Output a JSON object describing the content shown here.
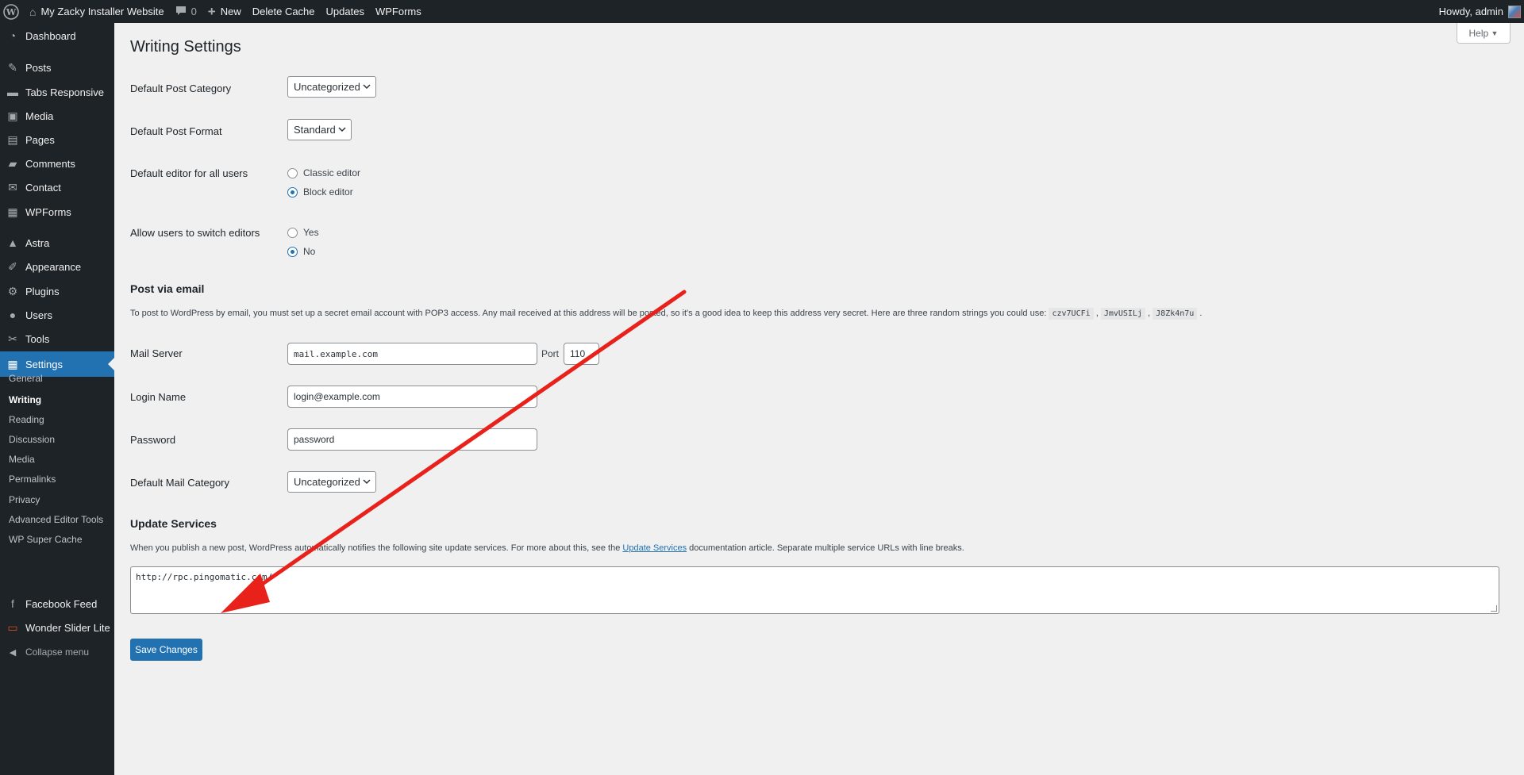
{
  "adminbar": {
    "site_name": "My Zacky Installer Website",
    "comments_count": "0",
    "new_label": "New",
    "delete_cache_label": "Delete Cache",
    "updates_label": "Updates",
    "wpforms_label": "WPForms",
    "howdy": "Howdy, admin"
  },
  "sidebar": {
    "items": [
      {
        "label": "Dashboard",
        "icon": "dashboard-icon"
      },
      {
        "label": "Posts",
        "icon": "pin-icon"
      },
      {
        "label": "Tabs Responsive",
        "icon": "folder-icon"
      },
      {
        "label": "Media",
        "icon": "media-icon"
      },
      {
        "label": "Pages",
        "icon": "pages-icon"
      },
      {
        "label": "Comments",
        "icon": "comment-icon"
      },
      {
        "label": "Contact",
        "icon": "mail-icon"
      },
      {
        "label": "WPForms",
        "icon": "forms-icon"
      },
      {
        "label": "Astra",
        "icon": "astra-icon"
      },
      {
        "label": "Appearance",
        "icon": "brush-icon"
      },
      {
        "label": "Plugins",
        "icon": "plugin-icon"
      },
      {
        "label": "Users",
        "icon": "user-icon"
      },
      {
        "label": "Tools",
        "icon": "wrench-icon"
      },
      {
        "label": "Settings",
        "icon": "settings-icon"
      }
    ],
    "submenu": [
      "General",
      "Writing",
      "Reading",
      "Discussion",
      "Media",
      "Permalinks",
      "Privacy",
      "Advanced Editor Tools",
      "WP Super Cache"
    ],
    "extra": [
      {
        "label": "Facebook Feed",
        "icon": "facebook-icon"
      },
      {
        "label": "Wonder Slider Lite",
        "icon": "monitor-icon"
      }
    ],
    "collapse_label": "Collapse menu"
  },
  "main": {
    "title": "Writing Settings",
    "help_label": "Help",
    "default_post_category": {
      "label": "Default Post Category",
      "value": "Uncategorized"
    },
    "default_post_format": {
      "label": "Default Post Format",
      "value": "Standard"
    },
    "default_editor": {
      "label": "Default editor for all users",
      "options": [
        "Classic editor",
        "Block editor"
      ],
      "selected": "Block editor"
    },
    "allow_switch": {
      "label": "Allow users to switch editors",
      "options": [
        "Yes",
        "No"
      ],
      "selected": "No"
    },
    "post_via_email": {
      "heading": "Post via email",
      "description": "To post to WordPress by email, you must set up a secret email account with POP3 access. Any mail received at this address will be posted, so it's a good idea to keep this address very secret. Here are three random strings you could use:",
      "codes": [
        "czv7UCFi",
        "JmvUSILj",
        "J8Zk4n7u"
      ]
    },
    "mail_server": {
      "label": "Mail Server",
      "value": "mail.example.com",
      "port_label": "Port",
      "port_value": "110"
    },
    "login_name": {
      "label": "Login Name",
      "value": "login@example.com"
    },
    "password": {
      "label": "Password",
      "value": "password"
    },
    "default_mail_category": {
      "label": "Default Mail Category",
      "value": "Uncategorized"
    },
    "update_services": {
      "heading": "Update Services",
      "desc_before": "When you publish a new post, WordPress automatically notifies the following site update services. For more about this, see the ",
      "link_text": "Update Services",
      "desc_after": " documentation article. Separate multiple service URLs with line breaks.",
      "textarea_value": "http://rpc.pingomatic.com/"
    },
    "save_label": "Save Changes"
  },
  "colors": {
    "accent": "#2271b1",
    "annotation_arrow": "#e8221b",
    "sidebar_bg": "#1d2327"
  }
}
